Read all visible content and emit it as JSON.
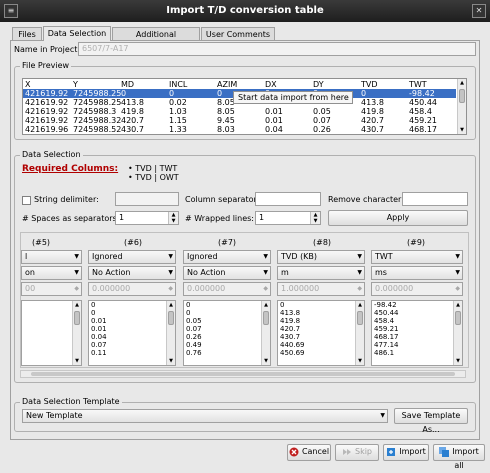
{
  "window": {
    "title": "Import T/D conversion table",
    "close_glyph": "✕"
  },
  "tabs": [
    "Files",
    "Data Selection",
    "Additional Parameters",
    "User Comments"
  ],
  "project": {
    "label": "Name in Project:",
    "value": "6507/7-A17"
  },
  "file_preview": {
    "title": "File Preview",
    "columns": [
      "X",
      "Y",
      "MD",
      "INCL",
      "AZIM",
      "DX",
      "DY",
      "TVD",
      "TWT"
    ],
    "rows": [
      [
        "421619.92",
        "7245988.25",
        "0",
        "0",
        "0",
        "0",
        "0",
        "0",
        "-98.42"
      ],
      [
        "421619.92",
        "7245988.25",
        "413.8",
        "0.02",
        "8.05",
        "",
        "",
        "413.8",
        "450.44"
      ],
      [
        "421619.92",
        "7245988.3",
        "419.8",
        "1.03",
        "8.05",
        "0.01",
        "0.05",
        "419.8",
        "458.4"
      ],
      [
        "421619.92",
        "7245988.32",
        "420.7",
        "1.15",
        "9.45",
        "0.01",
        "0.07",
        "420.7",
        "459.21"
      ],
      [
        "421619.96",
        "7245988.52",
        "430.7",
        "1.33",
        "8.03",
        "0.04",
        "0.26",
        "430.7",
        "468.17"
      ]
    ],
    "tooltip": "Start data import from here"
  },
  "data_selection": {
    "title": "Data Selection",
    "required_label": "Required Columns:",
    "required_options": [
      "• TVD | TWT",
      "• TVD | OWT"
    ],
    "string_delimiter_label": "String delimiter:",
    "column_separator_label": "Column separator:",
    "remove_character_label": "Remove character:",
    "spaces_label": "# Spaces as separators:",
    "spaces_value": "1",
    "wrapped_label": "# Wrapped lines:",
    "wrapped_value": "1",
    "apply_label": "Apply"
  },
  "columns": [
    {
      "head": "(#5)",
      "type": "l",
      "action": "on",
      "scale": "00",
      "values": []
    },
    {
      "head": "(#6)",
      "type": "Ignored",
      "action": "No Action",
      "scale": "0.000000",
      "values": [
        "0",
        "0",
        "0.01",
        "0.01",
        "0.04",
        "0.07",
        "0.11"
      ]
    },
    {
      "head": "(#7)",
      "type": "Ignored",
      "action": "No Action",
      "scale": "0.000000",
      "values": [
        "0",
        "0",
        "0.05",
        "0.07",
        "0.26",
        "0.49",
        "0.76"
      ]
    },
    {
      "head": "(#8)",
      "type": "TVD (KB)",
      "action": "m",
      "scale": "1.000000",
      "values": [
        "0",
        "413.8",
        "419.8",
        "420.7",
        "430.7",
        "440.69",
        "450.69"
      ]
    },
    {
      "head": "(#9)",
      "type": "TWT",
      "action": "ms",
      "scale": "0.000000",
      "values": [
        "-98.42",
        "450.44",
        "458.4",
        "459.21",
        "468.17",
        "477.14",
        "486.1"
      ]
    }
  ],
  "template": {
    "title": "Data Selection Template",
    "value": "New Template",
    "save_label": "Save Template As..."
  },
  "footer": {
    "cancel": "Cancel",
    "skip": "Skip",
    "import": "Import",
    "import_all": "Import all"
  },
  "colors": {
    "selection": "#3a6fc4",
    "required": "#b00000",
    "cancel_icon": "#c02020",
    "import_icon": "#2a7fd0"
  }
}
